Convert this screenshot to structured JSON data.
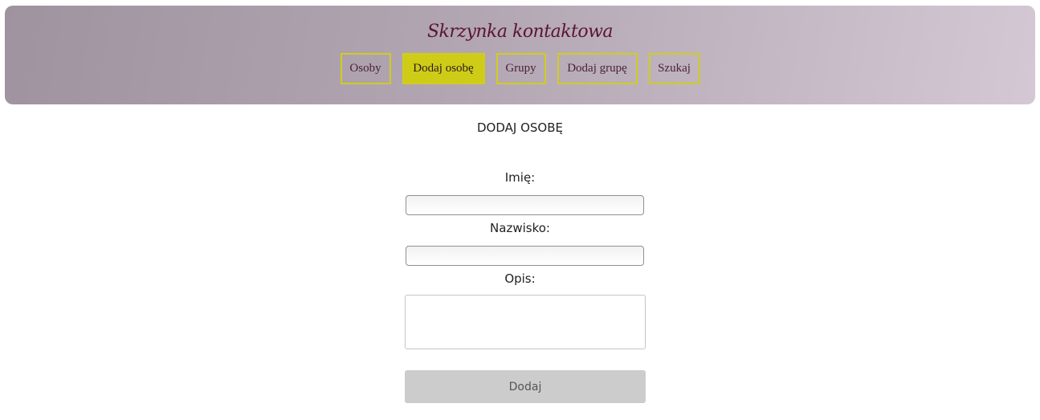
{
  "header": {
    "title": "Skrzynka kontaktowa",
    "nav": [
      {
        "label": "Osoby",
        "active": false
      },
      {
        "label": "Dodaj osobę",
        "active": true
      },
      {
        "label": "Grupy",
        "active": false
      },
      {
        "label": "Dodaj grupę",
        "active": false
      },
      {
        "label": "Szukaj",
        "active": false
      }
    ]
  },
  "main": {
    "heading": "DODAJ OSOBĘ",
    "form": {
      "first_name_label": "Imię:",
      "first_name_value": "",
      "last_name_label": "Nazwisko:",
      "last_name_value": "",
      "description_label": "Opis:",
      "description_value": "",
      "submit_label": "Dodaj"
    }
  },
  "colors": {
    "accent": "#cfcc18",
    "title": "#5a1530",
    "button_bg": "#cccccc"
  }
}
